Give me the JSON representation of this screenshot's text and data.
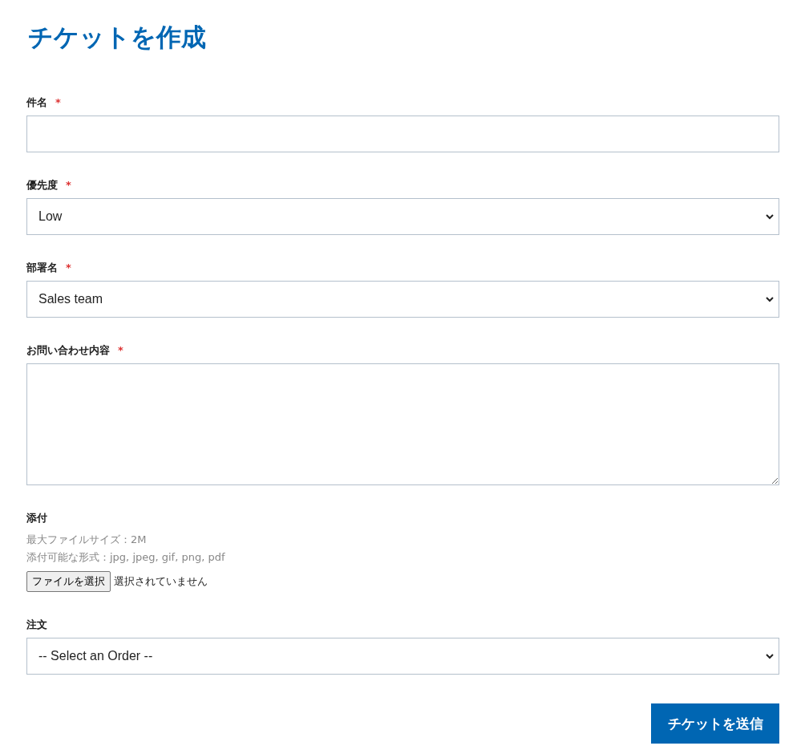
{
  "title": "チケットを作成",
  "fields": [
    {
      "kind": "text",
      "label": "件名",
      "required_mark": "*"
    },
    {
      "kind": "select",
      "label": "優先度",
      "required_mark": "*",
      "value": "Low"
    },
    {
      "kind": "select",
      "label": "部署名",
      "required_mark": "*",
      "value": "Sales team"
    },
    {
      "kind": "textarea",
      "label": "お問い合わせ内容",
      "required_mark": "*"
    },
    {
      "kind": "file",
      "label": "添付",
      "hints": [
        "最大ファイルサイズ：2M",
        "添付可能な形式：jpg, jpeg, gif, png, pdf"
      ],
      "button": "ファイルを選択",
      "status": "選択されていません"
    },
    {
      "kind": "select",
      "label": "注文",
      "value": "-- Select an Order --"
    }
  ],
  "submit": "チケットを送信"
}
